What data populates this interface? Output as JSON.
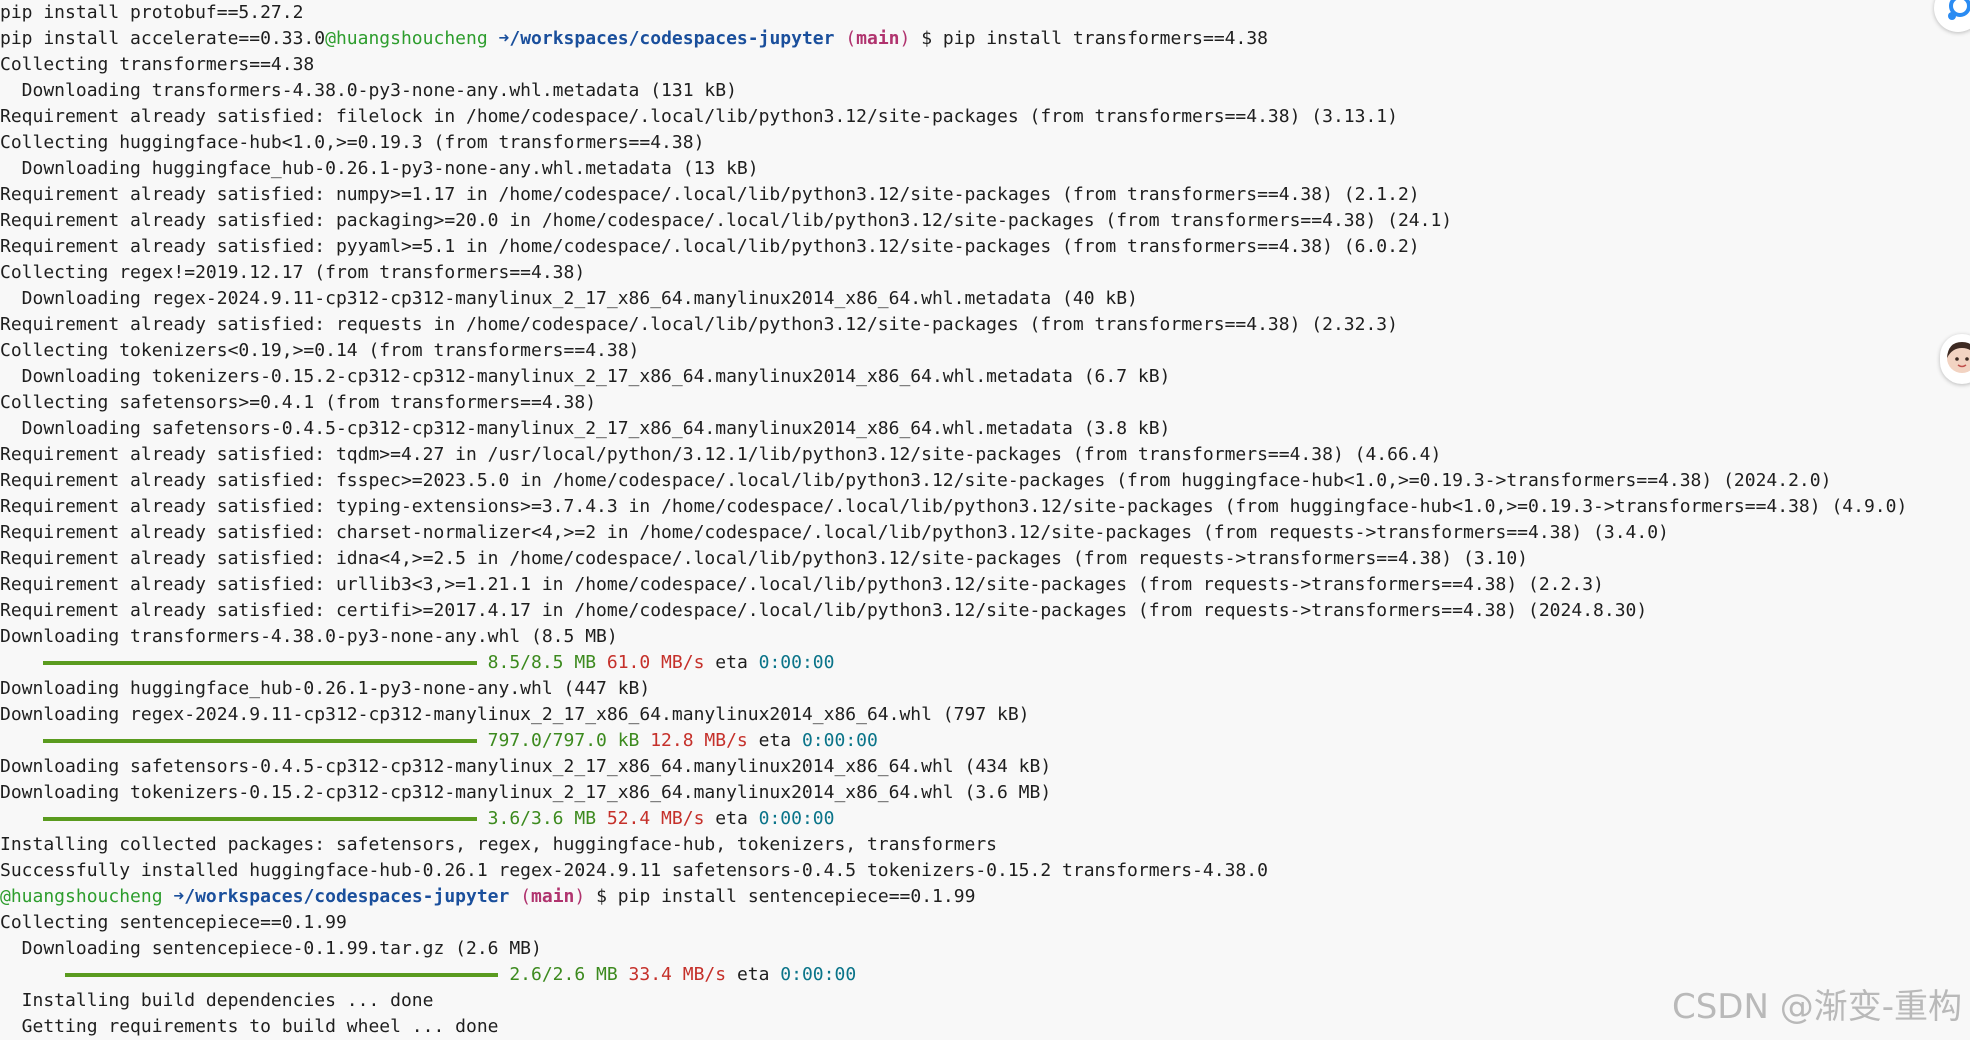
{
  "terminal": {
    "lines": [
      {
        "kind": "text",
        "text": "pip install protobuf==5.27.2"
      },
      {
        "kind": "prompt_mixed",
        "prefix": "pip install accelerate==0.33.0",
        "user": "@huangshoucheng",
        "arrow": "➜",
        "path": "/workspaces/codespaces-jupyter",
        "branch_open": "(",
        "branch": "main",
        "branch_close": ")",
        "dollar": "$",
        "cmd": "pip install transformers==4.38"
      },
      {
        "kind": "text",
        "text": "Collecting transformers==4.38"
      },
      {
        "kind": "text",
        "text": "  Downloading transformers-4.38.0-py3-none-any.whl.metadata (131 kB)"
      },
      {
        "kind": "text",
        "text": "Requirement already satisfied: filelock in /home/codespace/.local/lib/python3.12/site-packages (from transformers==4.38) (3.13.1)"
      },
      {
        "kind": "text",
        "text": "Collecting huggingface-hub<1.0,>=0.19.3 (from transformers==4.38)"
      },
      {
        "kind": "text",
        "text": "  Downloading huggingface_hub-0.26.1-py3-none-any.whl.metadata (13 kB)"
      },
      {
        "kind": "text",
        "text": "Requirement already satisfied: numpy>=1.17 in /home/codespace/.local/lib/python3.12/site-packages (from transformers==4.38) (2.1.2)"
      },
      {
        "kind": "text",
        "text": "Requirement already satisfied: packaging>=20.0 in /home/codespace/.local/lib/python3.12/site-packages (from transformers==4.38) (24.1)"
      },
      {
        "kind": "text",
        "text": "Requirement already satisfied: pyyaml>=5.1 in /home/codespace/.local/lib/python3.12/site-packages (from transformers==4.38) (6.0.2)"
      },
      {
        "kind": "text",
        "text": "Collecting regex!=2019.12.17 (from transformers==4.38)"
      },
      {
        "kind": "text",
        "text": "  Downloading regex-2024.9.11-cp312-cp312-manylinux_2_17_x86_64.manylinux2014_x86_64.whl.metadata (40 kB)"
      },
      {
        "kind": "text",
        "text": "Requirement already satisfied: requests in /home/codespace/.local/lib/python3.12/site-packages (from transformers==4.38) (2.32.3)"
      },
      {
        "kind": "text",
        "text": "Collecting tokenizers<0.19,>=0.14 (from transformers==4.38)"
      },
      {
        "kind": "text",
        "text": "  Downloading tokenizers-0.15.2-cp312-cp312-manylinux_2_17_x86_64.manylinux2014_x86_64.whl.metadata (6.7 kB)"
      },
      {
        "kind": "text",
        "text": "Collecting safetensors>=0.4.1 (from transformers==4.38)"
      },
      {
        "kind": "text",
        "text": "  Downloading safetensors-0.4.5-cp312-cp312-manylinux_2_17_x86_64.manylinux2014_x86_64.whl.metadata (3.8 kB)"
      },
      {
        "kind": "text",
        "text": "Requirement already satisfied: tqdm>=4.27 in /usr/local/python/3.12.1/lib/python3.12/site-packages (from transformers==4.38) (4.66.4)"
      },
      {
        "kind": "text",
        "text": "Requirement already satisfied: fsspec>=2023.5.0 in /home/codespace/.local/lib/python3.12/site-packages (from huggingface-hub<1.0,>=0.19.3->transformers==4.38) (2024.2.0)"
      },
      {
        "kind": "text",
        "text": "Requirement already satisfied: typing-extensions>=3.7.4.3 in /home/codespace/.local/lib/python3.12/site-packages (from huggingface-hub<1.0,>=0.19.3->transformers==4.38) (4.9.0)"
      },
      {
        "kind": "text",
        "text": "Requirement already satisfied: charset-normalizer<4,>=2 in /home/codespace/.local/lib/python3.12/site-packages (from requests->transformers==4.38) (3.4.0)"
      },
      {
        "kind": "text",
        "text": "Requirement already satisfied: idna<4,>=2.5 in /home/codespace/.local/lib/python3.12/site-packages (from requests->transformers==4.38) (3.10)"
      },
      {
        "kind": "text",
        "text": "Requirement already satisfied: urllib3<3,>=1.21.1 in /home/codespace/.local/lib/python3.12/site-packages (from requests->transformers==4.38) (2.2.3)"
      },
      {
        "kind": "text",
        "text": "Requirement already satisfied: certifi>=2017.4.17 in /home/codespace/.local/lib/python3.12/site-packages (from requests->transformers==4.38) (2024.8.30)"
      },
      {
        "kind": "text",
        "text": "Downloading transformers-4.38.0-py3-none-any.whl (8.5 MB)"
      },
      {
        "kind": "progress",
        "indent": 4,
        "progress": 1.0,
        "size": "8.5/8.5 MB",
        "speed": "61.0 MB/s",
        "eta_label": "eta",
        "eta": "0:00:00"
      },
      {
        "kind": "text",
        "text": "Downloading huggingface_hub-0.26.1-py3-none-any.whl (447 kB)"
      },
      {
        "kind": "text",
        "text": "Downloading regex-2024.9.11-cp312-cp312-manylinux_2_17_x86_64.manylinux2014_x86_64.whl (797 kB)"
      },
      {
        "kind": "progress",
        "indent": 4,
        "progress": 1.0,
        "size": "797.0/797.0 kB",
        "speed": "12.8 MB/s",
        "eta_label": "eta",
        "eta": "0:00:00"
      },
      {
        "kind": "text",
        "text": "Downloading safetensors-0.4.5-cp312-cp312-manylinux_2_17_x86_64.manylinux2014_x86_64.whl (434 kB)"
      },
      {
        "kind": "text",
        "text": "Downloading tokenizers-0.15.2-cp312-cp312-manylinux_2_17_x86_64.manylinux2014_x86_64.whl (3.6 MB)"
      },
      {
        "kind": "progress",
        "indent": 4,
        "progress": 1.0,
        "size": "3.6/3.6 MB",
        "speed": "52.4 MB/s",
        "eta_label": "eta",
        "eta": "0:00:00"
      },
      {
        "kind": "text",
        "text": "Installing collected packages: safetensors, regex, huggingface-hub, tokenizers, transformers"
      },
      {
        "kind": "text",
        "text": "Successfully installed huggingface-hub-0.26.1 regex-2024.9.11 safetensors-0.4.5 tokenizers-0.15.2 transformers-4.38.0"
      },
      {
        "kind": "prompt",
        "user": "@huangshoucheng",
        "arrow": "➜",
        "path": "/workspaces/codespaces-jupyter",
        "branch_open": "(",
        "branch": "main",
        "branch_close": ")",
        "dollar": "$",
        "cmd": "pip install sentencepiece==0.1.99"
      },
      {
        "kind": "text",
        "text": "Collecting sentencepiece==0.1.99"
      },
      {
        "kind": "text",
        "text": "  Downloading sentencepiece-0.1.99.tar.gz (2.6 MB)"
      },
      {
        "kind": "progress",
        "indent": 6,
        "progress": 1.0,
        "size": "2.6/2.6 MB",
        "speed": "33.4 MB/s",
        "eta_label": "eta",
        "eta": "0:00:00"
      },
      {
        "kind": "text",
        "text": "  Installing build dependencies ... done"
      },
      {
        "kind": "text",
        "text": "  Getting requirements to build wheel ... done"
      }
    ]
  },
  "side_icons": [
    {
      "name": "chat-assistant-icon"
    },
    {
      "name": "user-avatar-icon"
    }
  ],
  "watermark": "CSDN @渐变-重构",
  "colors": {
    "background": "#f8f8f8",
    "text": "#1e1e1e",
    "progress_green": "#3c8a1e",
    "speed_red": "#c5302a",
    "eta_cyan": "#0a7489",
    "prompt_user": "#2d9d2d",
    "prompt_path": "#1a4f9c",
    "prompt_branch": "#b0336e"
  }
}
